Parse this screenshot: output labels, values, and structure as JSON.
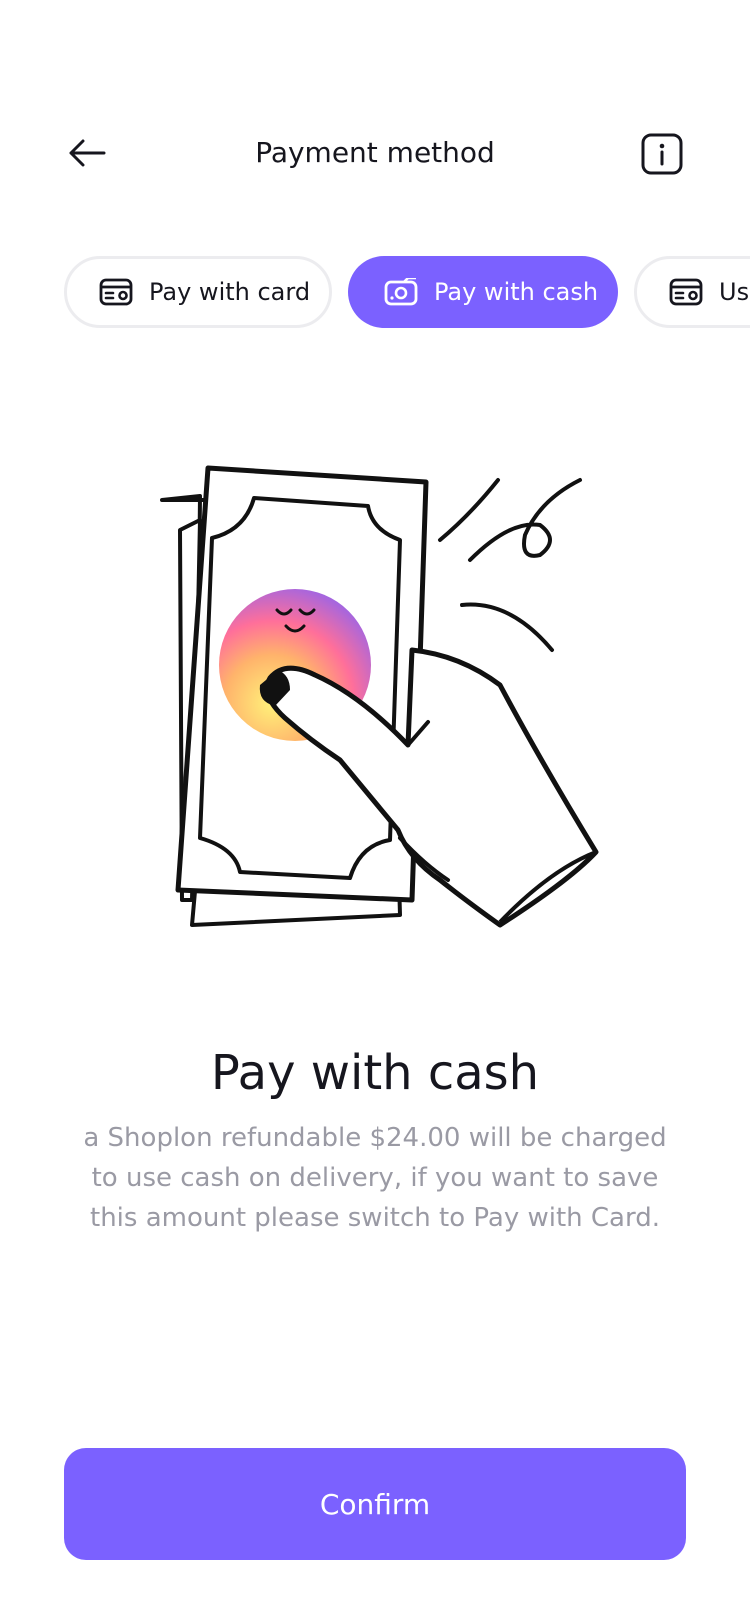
{
  "header": {
    "title": "Payment method"
  },
  "tabs": [
    {
      "label": "Pay with card",
      "icon": "card-icon",
      "active": false
    },
    {
      "label": "Pay with cash",
      "icon": "cash-icon",
      "active": true
    },
    {
      "label": "Use",
      "icon": "card-icon",
      "active": false
    }
  ],
  "main": {
    "title": "Pay with cash",
    "description": "a Shoplon refundable $24.00 will be charged to use cash on delivery, if you want to save this amount please switch to Pay with Card."
  },
  "footer": {
    "confirm_label": "Confirm"
  },
  "colors": {
    "accent": "#7b61ff",
    "text_primary": "#16161e",
    "text_secondary": "#9a9aa4",
    "tab_border": "#ececef"
  }
}
